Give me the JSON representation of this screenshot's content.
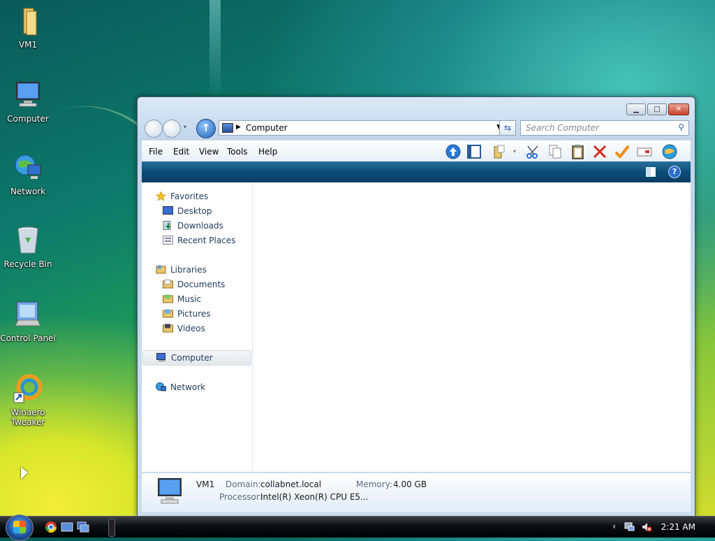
{
  "desktop": {
    "icons": [
      {
        "label": "VM1"
      },
      {
        "label": "Computer"
      },
      {
        "label": "Network"
      },
      {
        "label": "Recycle Bin"
      },
      {
        "label": "Control Panel"
      },
      {
        "label": "Winaero\nTweaker"
      }
    ]
  },
  "window": {
    "address": "Computer",
    "search_placeholder": "Search Computer",
    "menu": [
      "File",
      "Edit",
      "View",
      "Tools",
      "Help"
    ],
    "nav": {
      "favorites": {
        "label": "Favorites",
        "items": [
          "Desktop",
          "Downloads",
          "Recent Places"
        ]
      },
      "libraries": {
        "label": "Libraries",
        "items": [
          "Documents",
          "Music",
          "Pictures",
          "Videos"
        ]
      },
      "computer": "Computer",
      "network": "Network"
    },
    "details": {
      "name": "VM1",
      "domain_label": "Domain:",
      "domain_value": "collabnet.local",
      "memory_label": "Memory:",
      "memory_value": "4.00 GB",
      "processor_label": "Processor:",
      "processor_value": "Intel(R) Xeon(R) CPU E5..."
    }
  },
  "taskbar": {
    "clock": "2:21 AM"
  },
  "colors": {
    "accent": "#0d4c78",
    "nav_text": "#1f3b5c"
  }
}
